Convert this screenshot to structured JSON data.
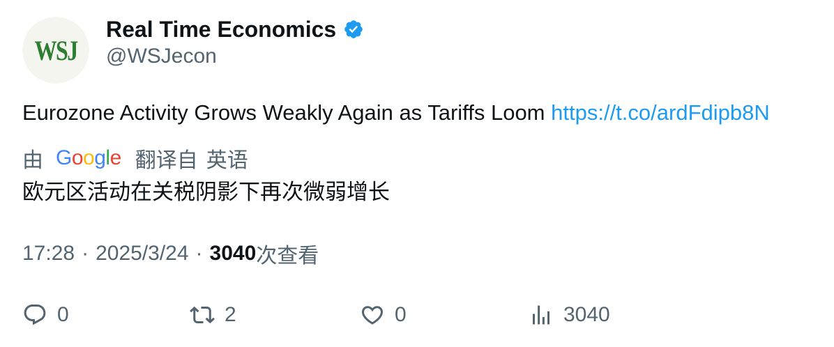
{
  "author": {
    "avatar_text": "WSJ",
    "display_name": "Real Time Economics",
    "handle": "@WSJecon",
    "verified_icon": "verified-badge-icon",
    "verified_color": "#1d9bf0"
  },
  "tweet": {
    "text": "Eurozone Activity Grows Weakly Again as Tariffs Loom",
    "link": "https://t.co/ardFdipb8N"
  },
  "translation": {
    "prefix": "由",
    "provider_letters": [
      "G",
      "o",
      "o",
      "g",
      "l",
      "e"
    ],
    "suffix": "翻译自",
    "language": "英语",
    "text": "欧元区活动在关税阴影下再次微弱增长"
  },
  "meta": {
    "time": "17:28",
    "separator": "·",
    "date": "2025/3/24",
    "views": "3040",
    "views_label": "次查看"
  },
  "actions": {
    "reply": {
      "icon": "reply-icon",
      "count": "0"
    },
    "retweet": {
      "icon": "retweet-icon",
      "count": "2"
    },
    "like": {
      "icon": "heart-icon",
      "count": "0"
    },
    "views": {
      "icon": "analytics-icon",
      "count": "3040"
    }
  },
  "colors": {
    "link": "#1d9bf0",
    "secondary_text": "#536471",
    "primary_text": "#0f1419",
    "avatar_logo": "#2e7d32"
  }
}
